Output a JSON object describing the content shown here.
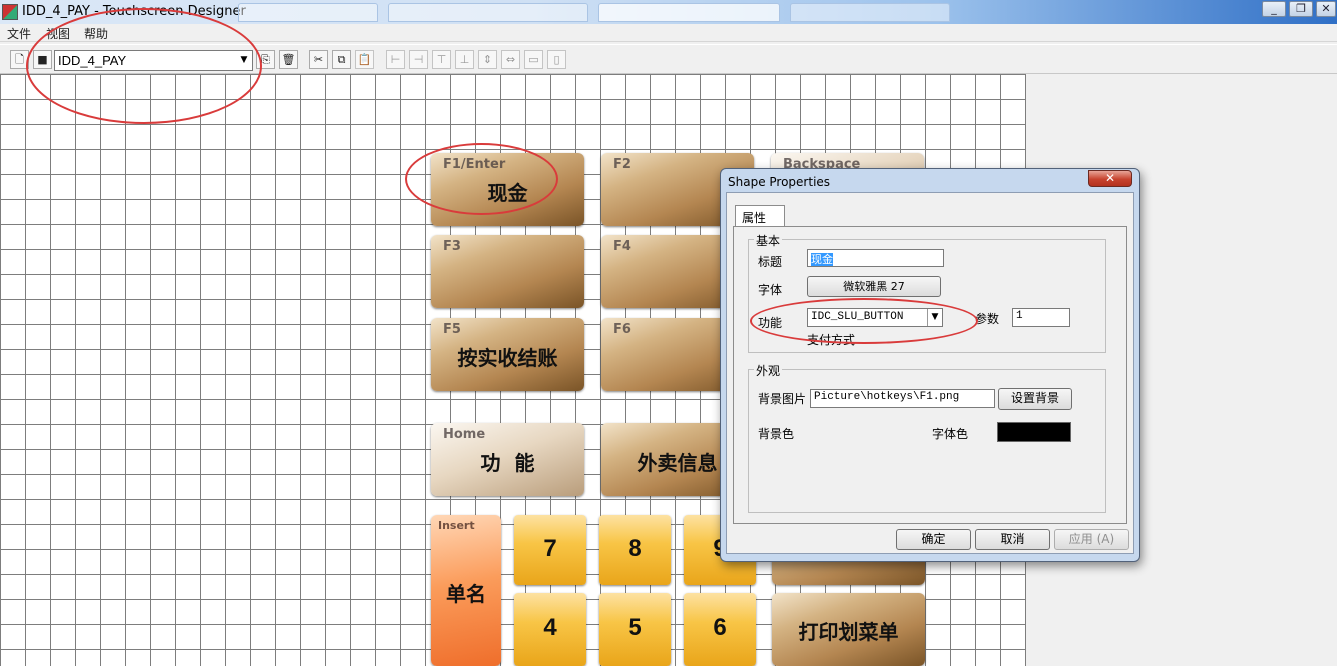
{
  "window": {
    "title": "IDD_4_PAY - Touchscreen Designer",
    "controls": {
      "minimize": "_",
      "restore": "❐",
      "close": "✕"
    }
  },
  "menu": {
    "items": [
      "文件",
      "视图",
      "帮助"
    ]
  },
  "toolbar": {
    "screen_select": "IDD_4_PAY",
    "buttons": [
      "new-icon",
      "save-icon",
      "import-icon",
      "delete-icon",
      "cut-icon",
      "copy-icon",
      "paste-icon",
      "align-left-icon",
      "align-right-icon",
      "align-top-icon",
      "align-bottom-icon",
      "center-vertical-icon",
      "center-horizontal-icon",
      "same-width-icon",
      "same-height-icon"
    ]
  },
  "hotkeys": [
    {
      "key": "F1/Enter",
      "label": "现金",
      "style": "brown"
    },
    {
      "key": "F2",
      "label": "",
      "style": "brown"
    },
    {
      "key": "Backspace",
      "label": "",
      "style": "light"
    },
    {
      "key": "F3",
      "label": "",
      "style": "brown"
    },
    {
      "key": "F4",
      "label": "",
      "style": "brown"
    },
    {
      "key": "F5",
      "label": "按实收结账",
      "style": "brown"
    },
    {
      "key": "F6",
      "label": "",
      "style": "brown"
    },
    {
      "key": "Home",
      "label": "功  能",
      "style": "light"
    },
    {
      "key": "",
      "label": "外卖信息",
      "style": "brown"
    },
    {
      "key": "Insert",
      "label": "单名",
      "style": "orange"
    },
    {
      "key": "",
      "label": "7",
      "style": "yellow"
    },
    {
      "key": "",
      "label": "8",
      "style": "yellow"
    },
    {
      "key": "",
      "label": "9",
      "style": "yellow"
    },
    {
      "key": "",
      "label": "",
      "style": "brown"
    },
    {
      "key": "",
      "label": "4",
      "style": "yellow"
    },
    {
      "key": "",
      "label": "5",
      "style": "yellow"
    },
    {
      "key": "",
      "label": "6",
      "style": "yellow"
    },
    {
      "key": "",
      "label": "打印划菜单",
      "style": "brown"
    }
  ],
  "dialog": {
    "title": "Shape Properties",
    "close": "✕",
    "tab": "属性",
    "basic": {
      "group_label": "基本",
      "title_label": "标题",
      "title_value": "现金",
      "font_label": "字体",
      "font_value": "微软雅黑 27",
      "function_label": "功能",
      "function_value": "IDC_SLU_BUTTON",
      "function_desc": "支付方式",
      "param_label": "参数",
      "param_value": "1"
    },
    "appearance": {
      "group_label": "外观",
      "bg_image_label": "背景图片",
      "bg_image_value": "Picture\\hotkeys\\F1.png",
      "set_bg_button": "设置背景",
      "bg_color_label": "背景色",
      "font_color_label": "字体色",
      "font_color": "#000000"
    },
    "buttons": {
      "ok": "确定",
      "cancel": "取消",
      "apply": "应用 (A)"
    }
  },
  "colors": {
    "annotation": "#d93b3b",
    "grid": "#7d7d7d",
    "title_highlight": "#3399ff"
  }
}
